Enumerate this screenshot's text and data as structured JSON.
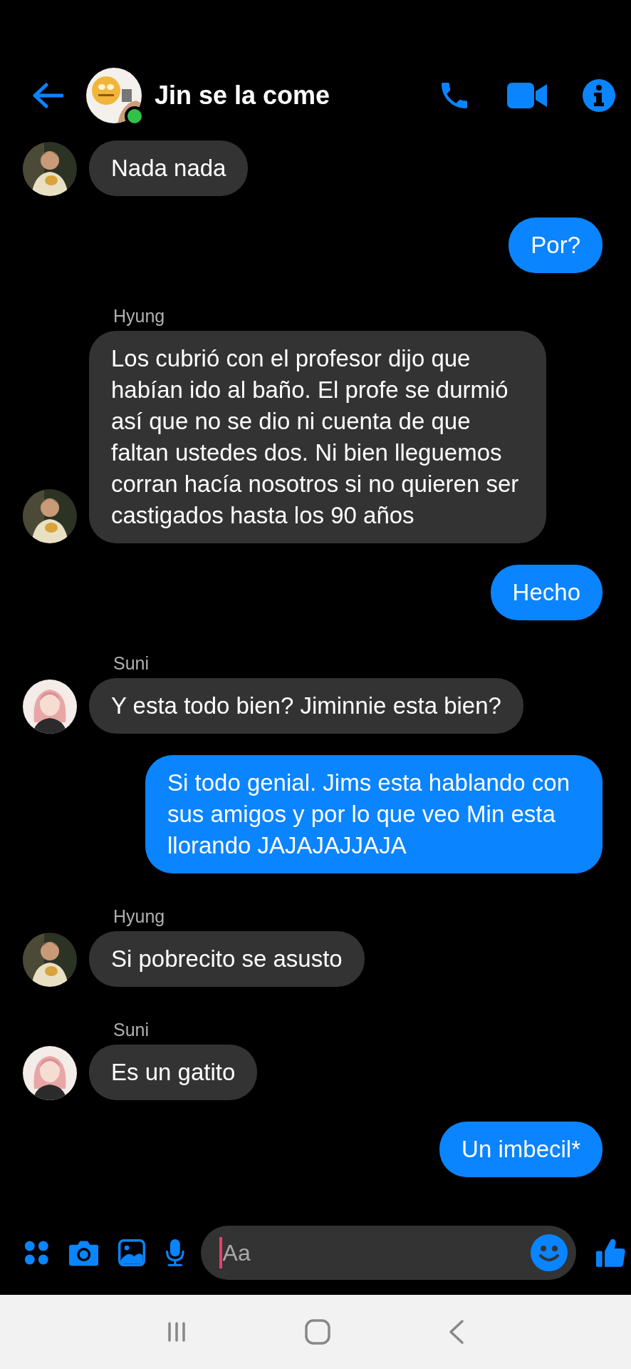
{
  "header": {
    "title": "Jin se la come",
    "online": true
  },
  "messages": [
    {
      "kind": "incoming",
      "light_avatar": false,
      "text": "Nada nada"
    },
    {
      "kind": "outgoing",
      "text": "Por?"
    },
    {
      "kind": "incoming",
      "sender": "Hyung",
      "light_avatar": false,
      "text": "Los cubrió con el profesor dijo que habían ido al baño. El profe se durmió así que no se dio ni cuenta de que faltan ustedes dos. Ni bien lleguemos corran hacía nosotros si no quieren ser castigados hasta los 90 años"
    },
    {
      "kind": "outgoing",
      "text": "Hecho"
    },
    {
      "kind": "incoming",
      "sender": "Suni",
      "light_avatar": true,
      "text": "Y esta todo bien? Jiminnie esta bien?"
    },
    {
      "kind": "outgoing",
      "text": "Si todo genial. Jims esta hablando con sus amigos y por lo que veo Min esta llorando JAJAJAJJAJA"
    },
    {
      "kind": "incoming",
      "sender": "Hyung",
      "light_avatar": false,
      "text": "Si pobrecito se asusto"
    },
    {
      "kind": "incoming",
      "sender": "Suni",
      "light_avatar": true,
      "text": "Es un gatito"
    },
    {
      "kind": "outgoing",
      "text": "Un imbecil*"
    }
  ],
  "composer": {
    "placeholder": "Aa"
  }
}
